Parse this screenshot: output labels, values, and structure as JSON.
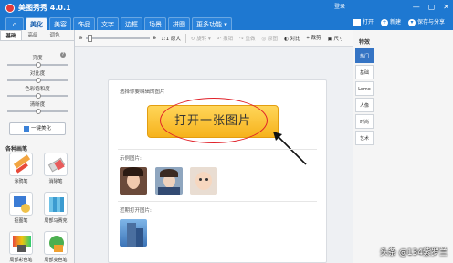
{
  "app": {
    "title": "美图秀秀 4.0.1",
    "login": "登录"
  },
  "window_controls": [
    "—",
    "▢",
    "✕"
  ],
  "tabs": [
    {
      "label": "⌂"
    },
    {
      "label": "美化"
    },
    {
      "label": "美容"
    },
    {
      "label": "饰品"
    },
    {
      "label": "文字"
    },
    {
      "label": "边框"
    },
    {
      "label": "场景"
    },
    {
      "label": "拼图"
    },
    {
      "label": "更多功能 ▾"
    }
  ],
  "right_tools": {
    "open": "打开",
    "new": "新建",
    "save": "保存与分享"
  },
  "left_subtabs": [
    "基础",
    "高级",
    "调色"
  ],
  "sliders": [
    "亮度",
    "对比度",
    "色彩饱和度",
    "清晰度"
  ],
  "beautify_button": "一键美化",
  "tools_section_title": "各种画笔",
  "tools": [
    {
      "label": "涂鸦笔"
    },
    {
      "label": "消除笔"
    },
    {
      "label": "抠图笔"
    },
    {
      "label": "局部马赛克"
    },
    {
      "label": "局部彩色笔"
    },
    {
      "label": "局部变色笔"
    }
  ],
  "toolbar": {
    "zoom_label": "1:1 原大",
    "items": [
      "旋转",
      "撤销",
      "重做",
      "原图",
      "对比",
      "裁剪",
      "尺寸"
    ]
  },
  "canvas": {
    "hint": "选择你要编辑的图片",
    "open_button": "打开一张图片",
    "sample_label": "示例图片:",
    "recent_label": "近期打开图片:"
  },
  "right_panel": {
    "title": "特效",
    "categories": [
      "热门",
      "基础",
      "Lomo",
      "人像",
      "时尚",
      "艺术"
    ]
  },
  "watermark": "头条 @134紫罗兰"
}
